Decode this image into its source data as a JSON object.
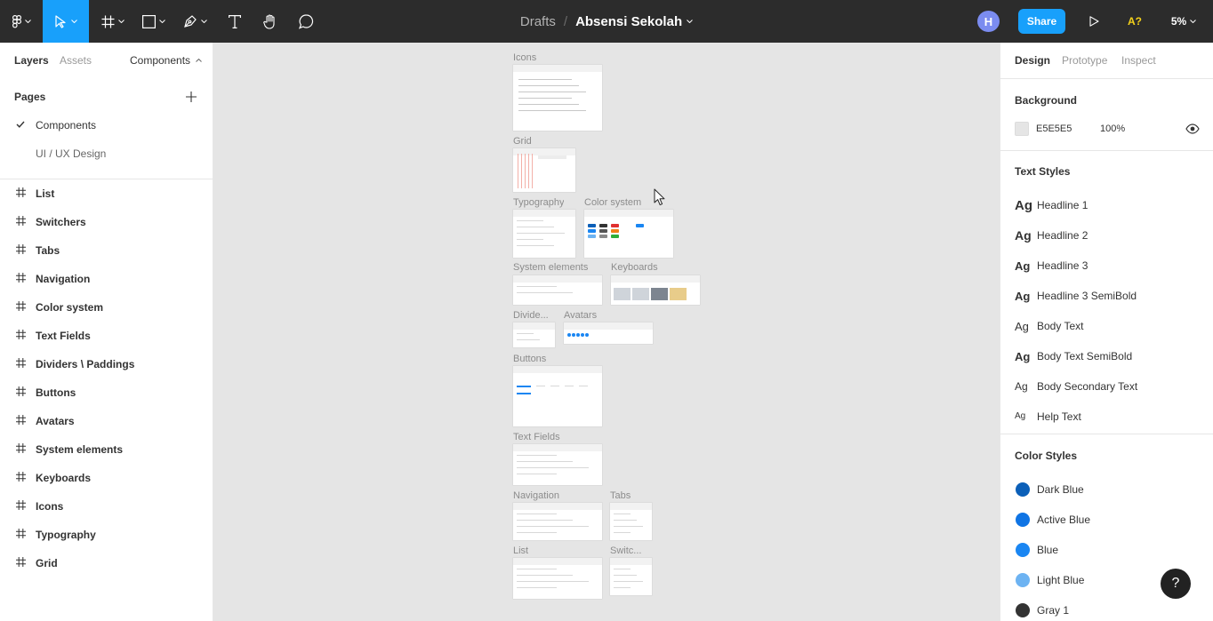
{
  "toolbar": {
    "breadcrumb_parent": "Drafts",
    "breadcrumb_separator": "/",
    "file_name": "Absensi Sekolah",
    "user_initial": "H",
    "share_label": "Share",
    "accessibility_label": "A?",
    "zoom_label": "5%",
    "active_tool": "move",
    "accent_color": "#18a0fb"
  },
  "left_panel": {
    "tabs": [
      "Layers",
      "Assets"
    ],
    "page_dropdown": "Components",
    "pages_header": "Pages",
    "pages": [
      {
        "label": "Components",
        "selected": true
      },
      {
        "label": "UI / UX Design",
        "selected": false
      }
    ],
    "layers": [
      "List",
      "Switchers",
      "Tabs",
      "Navigation",
      "Color system",
      "Text Fields",
      "Dividers \\ Paddings",
      "Buttons",
      "Avatars",
      "System elements",
      "Keyboards",
      "Icons",
      "Typography",
      "Grid"
    ]
  },
  "canvas": {
    "background": "#E5E5E5",
    "frames": [
      "Icons",
      "Grid",
      "Typography",
      "Color system",
      "System elements",
      "Keyboards",
      "Divide...",
      "Avatars",
      "Buttons",
      "Text Fields",
      "Navigation",
      "Tabs",
      "List",
      "Switc..."
    ]
  },
  "right_panel": {
    "tabs": [
      "Design",
      "Prototype",
      "Inspect"
    ],
    "background_header": "Background",
    "background_hex": "E5E5E5",
    "background_opacity": "100%",
    "text_styles_header": "Text Styles",
    "text_styles": [
      {
        "glyph": "Ag",
        "label": "Headline 1"
      },
      {
        "glyph": "Ag",
        "label": "Headline 2"
      },
      {
        "glyph": "Ag",
        "label": "Headline 3"
      },
      {
        "glyph": "Ag",
        "label": "Headline 3 SemiBold"
      },
      {
        "glyph": "Ag",
        "label": "Body Text"
      },
      {
        "glyph": "Ag",
        "label": "Body Text SemiBold"
      },
      {
        "glyph": "Ag",
        "label": "Body Secondary Text"
      },
      {
        "glyph": "Ag",
        "label": "Help Text"
      }
    ],
    "color_styles_header": "Color Styles",
    "color_styles": [
      {
        "label": "Dark Blue",
        "color": "#0b5fb8"
      },
      {
        "label": "Active Blue",
        "color": "#0f74e4"
      },
      {
        "label": "Blue",
        "color": "#1a86f2"
      },
      {
        "label": "Light Blue",
        "color": "#6db3f2"
      },
      {
        "label": "Gray 1",
        "color": "#333333"
      }
    ]
  },
  "help_label": "?"
}
